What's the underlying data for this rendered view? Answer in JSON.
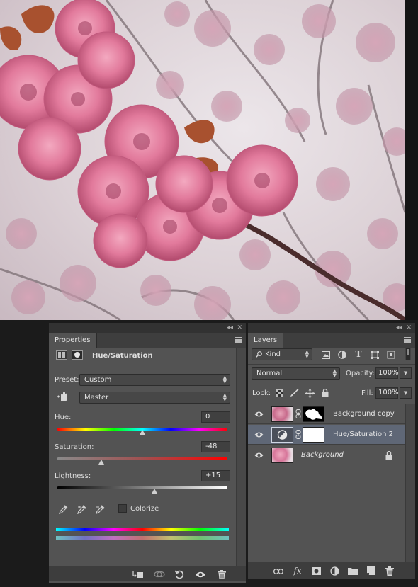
{
  "properties": {
    "tab_label": "Properties",
    "title": "Hue/Saturation",
    "preset_label": "Preset:",
    "preset_value": "Custom",
    "channel_value": "Master",
    "hue_label": "Hue:",
    "hue_value": "0",
    "saturation_label": "Saturation:",
    "saturation_value": "-48",
    "lightness_label": "Lightness:",
    "lightness_value": "+15",
    "colorize_label": "Colorize",
    "colorize_checked": false,
    "hue": 0,
    "saturation": -48,
    "lightness": 15
  },
  "layers": {
    "tab_label": "Layers",
    "filter_kind": "Kind",
    "blend_mode": "Normal",
    "opacity_label": "Opacity:",
    "opacity_value": "100%",
    "lock_label": "Lock:",
    "fill_label": "Fill:",
    "fill_value": "100%",
    "items": [
      {
        "name": "Background copy",
        "visible": true,
        "selected": false,
        "has_mask": true
      },
      {
        "name": "Hue/Saturation 2",
        "visible": true,
        "selected": true,
        "adjustment": true
      },
      {
        "name": "Background",
        "visible": true,
        "selected": false,
        "locked": true
      }
    ]
  },
  "colors": {
    "panel_bg": "#535353",
    "selection": "#5f6776",
    "photo_pink": "#d9708f"
  }
}
